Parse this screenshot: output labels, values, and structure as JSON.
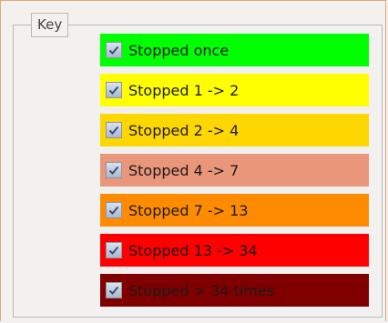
{
  "group": {
    "title": "Key"
  },
  "items": [
    {
      "label": "Stopped once",
      "color": "#00ff00",
      "checked": true
    },
    {
      "label": "Stopped 1 -> 2",
      "color": "#ffff00",
      "checked": true
    },
    {
      "label": "Stopped 2 -> 4",
      "color": "#ffd700",
      "checked": true
    },
    {
      "label": "Stopped 4 -> 7",
      "color": "#e9967a",
      "checked": true
    },
    {
      "label": "Stopped 7 -> 13",
      "color": "#ff8c00",
      "checked": true
    },
    {
      "label": "Stopped 13 -> 34",
      "color": "#ff0000",
      "checked": true
    },
    {
      "label": "Stopped > 34 times",
      "color": "#800000",
      "checked": true
    }
  ]
}
